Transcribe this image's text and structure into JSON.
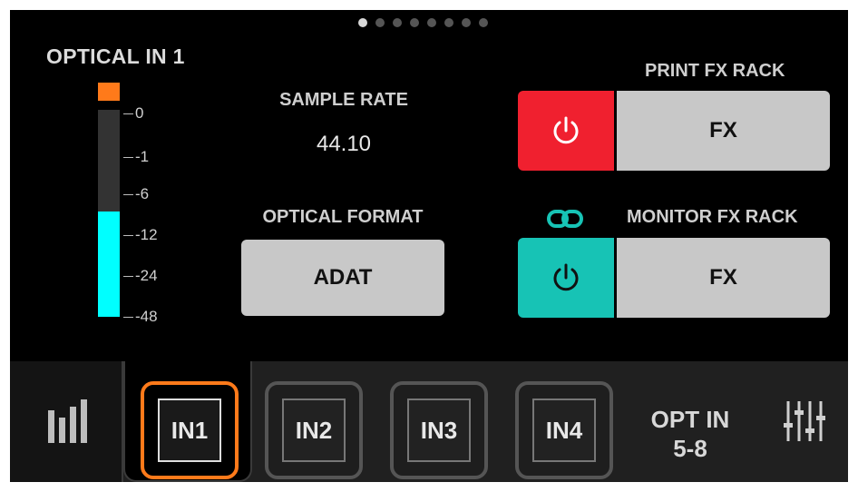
{
  "pager": {
    "count": 8,
    "active_index": 0
  },
  "channel": {
    "title": "OPTICAL IN 1"
  },
  "meter": {
    "scale": [
      "0",
      "-1",
      "-6",
      "-12",
      "-24",
      "-48"
    ],
    "level_fraction": 0.45,
    "clip_active": true,
    "colors": {
      "level": "#00ffff",
      "clip": "#ff7a1a"
    }
  },
  "sample_rate": {
    "label": "SAMPLE RATE",
    "value": "44.10"
  },
  "optical_format": {
    "label": "OPTICAL FORMAT",
    "value": "ADAT"
  },
  "print_fx_rack": {
    "label": "PRINT FX RACK",
    "power_icon": "power-icon",
    "power_color": "#f0202f",
    "button_label": "FX"
  },
  "monitor_fx_rack": {
    "label": "MONITOR FX RACK",
    "link_icon": "link-icon",
    "power_icon": "power-icon",
    "power_color": "#17c3b5",
    "button_label": "FX"
  },
  "bottom_bar": {
    "meters_tab_icon": "bar-graph-icon",
    "inputs": [
      {
        "label": "IN1",
        "selected": true
      },
      {
        "label": "IN2",
        "selected": false
      },
      {
        "label": "IN3",
        "selected": false
      },
      {
        "label": "IN4",
        "selected": false
      }
    ],
    "opt_in_line1": "OPT IN",
    "opt_in_line2": "5-8",
    "mixer_icon": "mixer-faders-icon",
    "selected_color": "#ff7a1a"
  }
}
